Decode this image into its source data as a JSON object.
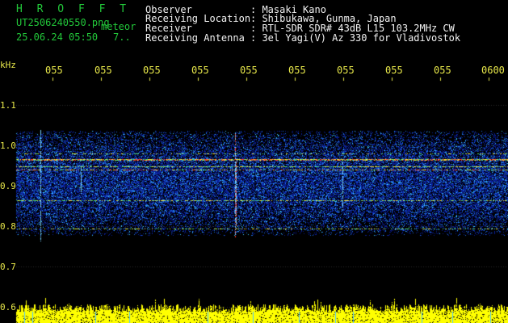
{
  "header": {
    "title": "H R O F F T",
    "filename": "UT2506240550.png",
    "meteor_label": "meteor",
    "datetime": "25.06.24 05:50",
    "count": "7..",
    "fields": [
      {
        "label": "Observer",
        "value": ": Masaki Kano"
      },
      {
        "label": "Receiving Location",
        "value": ": Shibukawa, Gunma, Japan"
      },
      {
        "label": "Receiver",
        "value": ": RTL-SDR SDR# 43dB L15 103.2MHz CW"
      },
      {
        "label": "Receiving Antenna",
        "value": ": 3el Yagi(V) Az 330 for Vladivostok"
      }
    ]
  },
  "axis": {
    "y_unit": "kHz",
    "y_ticks": [
      "1.1",
      "1.0",
      "0.9",
      "0.8",
      "0.7",
      "0.6"
    ],
    "x_ticks": [
      "055",
      "055",
      "055",
      "055",
      "055",
      "055",
      "055",
      "055",
      "055",
      "0600"
    ]
  },
  "colors": {
    "background": "#000000",
    "header_green": "#22c83a",
    "axis_yellow": "#e8e84a",
    "signal_low": "#0a1a8a",
    "signal_mid": "#1f7cff",
    "signal_high": "#ff2a1a",
    "amplitude": "#ffff00"
  }
}
